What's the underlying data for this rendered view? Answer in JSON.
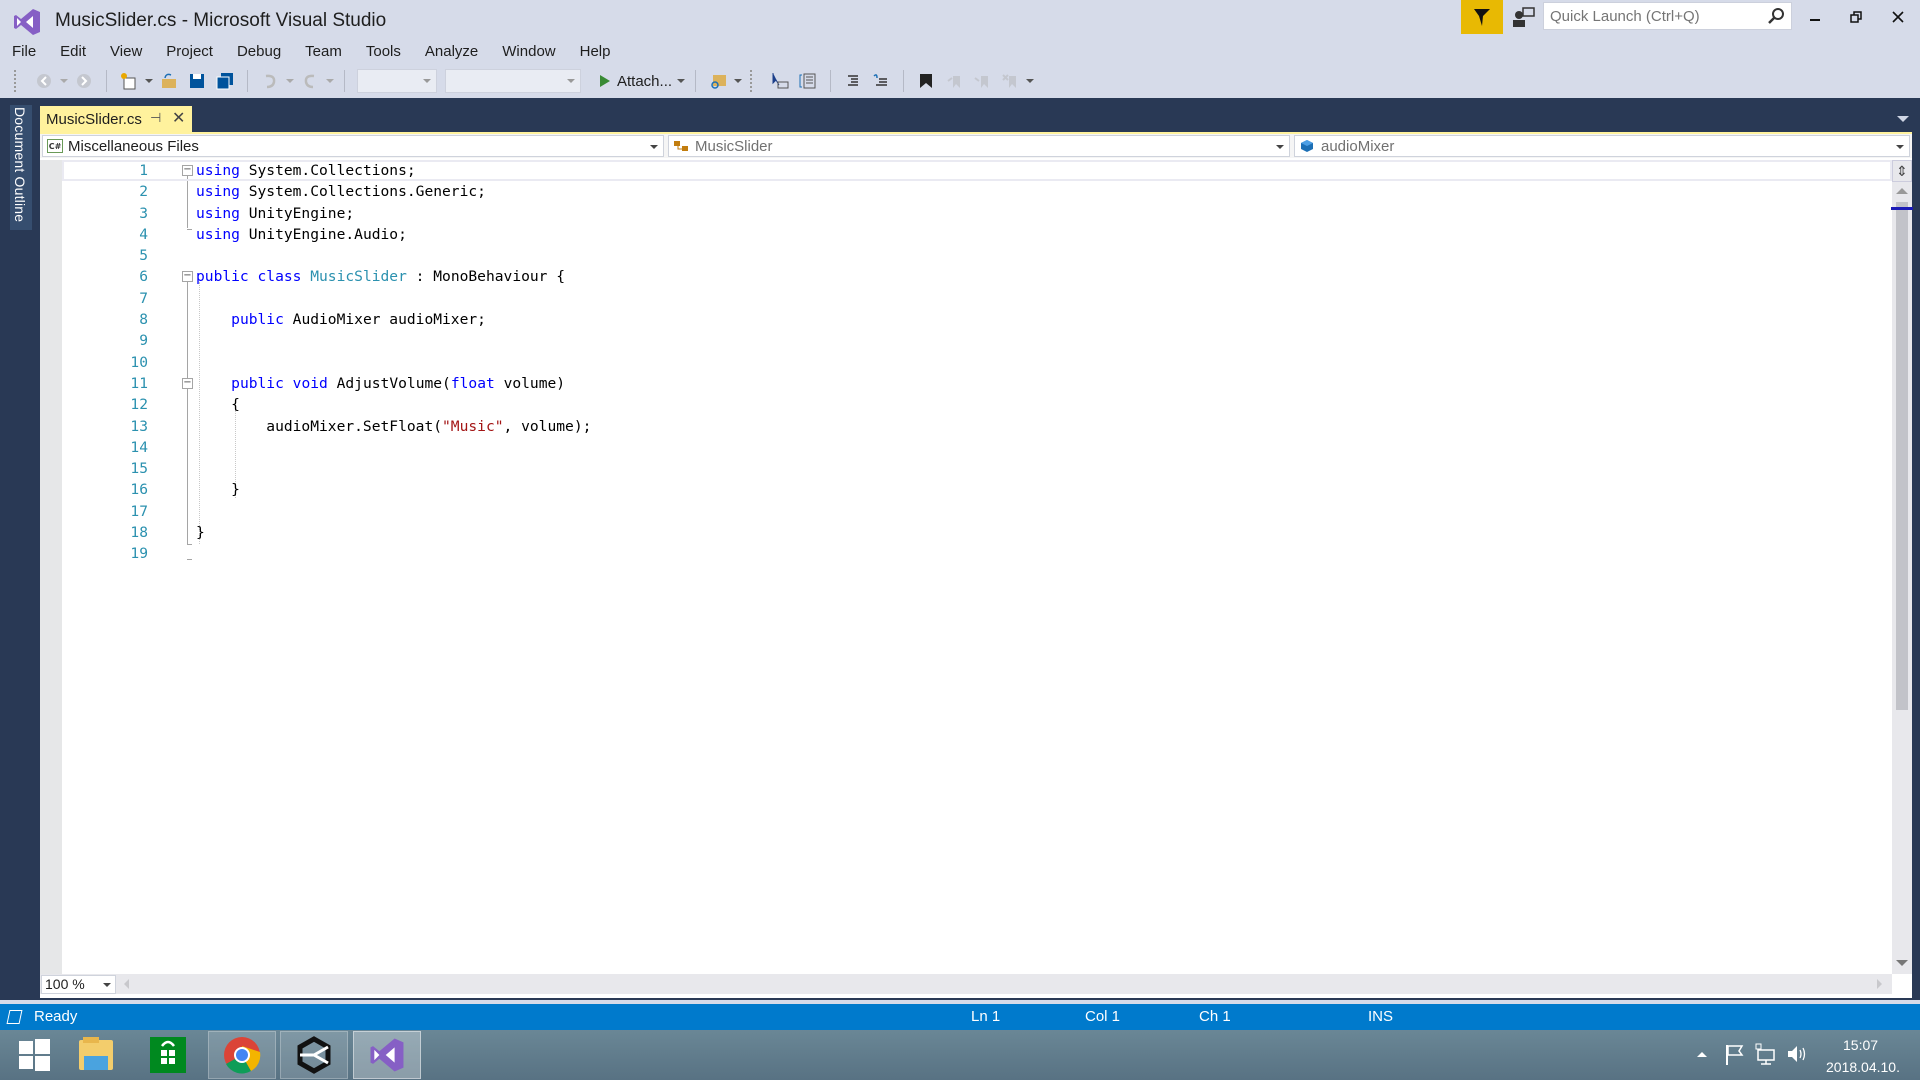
{
  "window": {
    "title": "MusicSlider.cs - Microsoft Visual Studio",
    "quick_launch_placeholder": "Quick Launch (Ctrl+Q)",
    "accent_color": "#007acc",
    "notification_color": "#e8b903"
  },
  "menu": [
    "File",
    "Edit",
    "View",
    "Project",
    "Debug",
    "Team",
    "Tools",
    "Analyze",
    "Window",
    "Help"
  ],
  "toolbar": {
    "attach_label": "Attach...",
    "solution_config": "",
    "solution_platform": ""
  },
  "side_panel": {
    "label": "Document Outline"
  },
  "document_tab": {
    "title": "MusicSlider.cs",
    "pin_glyph": "⊣",
    "close_glyph": "✕",
    "color": "#fff29d"
  },
  "navbar": {
    "project": "Miscellaneous Files",
    "type": "MusicSlider",
    "member": "audioMixer"
  },
  "editor": {
    "current_line": 1,
    "lines": [
      {
        "n": "1",
        "tokens": [
          [
            "kw",
            "using"
          ],
          [
            "",
            "System.Collections;"
          ]
        ]
      },
      {
        "n": "2",
        "tokens": [
          [
            "kw",
            "using"
          ],
          [
            "",
            "System.Collections.Generic;"
          ]
        ]
      },
      {
        "n": "3",
        "tokens": [
          [
            "kw",
            "using"
          ],
          [
            "",
            "UnityEngine;"
          ]
        ]
      },
      {
        "n": "4",
        "tokens": [
          [
            "kw",
            "using"
          ],
          [
            "",
            "UnityEngine.Audio;"
          ]
        ]
      },
      {
        "n": "5",
        "tokens": []
      },
      {
        "n": "6",
        "tokens": [
          [
            "kw",
            "public"
          ],
          [
            "kw",
            "class"
          ],
          [
            "ty",
            "MusicSlider"
          ],
          [
            "",
            " : MonoBehaviour {"
          ]
        ]
      },
      {
        "n": "7",
        "tokens": []
      },
      {
        "n": "8",
        "tokens": [
          [
            "",
            "    "
          ],
          [
            "kw",
            "public"
          ],
          [
            "",
            " AudioMixer audioMixer;"
          ]
        ]
      },
      {
        "n": "9",
        "tokens": []
      },
      {
        "n": "10",
        "tokens": []
      },
      {
        "n": "11",
        "tokens": [
          [
            "",
            "    "
          ],
          [
            "kw",
            "public"
          ],
          [
            "kw",
            "void"
          ],
          [
            "",
            " AdjustVolume("
          ],
          [
            "kw",
            "float"
          ],
          [
            "",
            " volume)"
          ]
        ]
      },
      {
        "n": "12",
        "tokens": [
          [
            "",
            "    {"
          ]
        ]
      },
      {
        "n": "13",
        "tokens": [
          [
            "",
            "        audioMixer.SetFloat("
          ],
          [
            "str",
            "\"Music\""
          ],
          [
            "",
            ", volume);"
          ]
        ]
      },
      {
        "n": "14",
        "tokens": []
      },
      {
        "n": "15",
        "tokens": []
      },
      {
        "n": "16",
        "tokens": [
          [
            "",
            "    }"
          ]
        ]
      },
      {
        "n": "17",
        "tokens": []
      },
      {
        "n": "18",
        "tokens": [
          [
            "",
            "}"
          ]
        ]
      },
      {
        "n": "19",
        "tokens": []
      }
    ]
  },
  "zoom_level": "100 %",
  "status": {
    "message": "Ready",
    "line": "Ln 1",
    "col": "Col 1",
    "ch": "Ch 1",
    "mode": "INS"
  },
  "taskbar": {
    "apps": [
      "start",
      "file-explorer",
      "store",
      "chrome",
      "unity",
      "visual-studio"
    ],
    "time": "15:07",
    "date": "2018.04.10."
  }
}
